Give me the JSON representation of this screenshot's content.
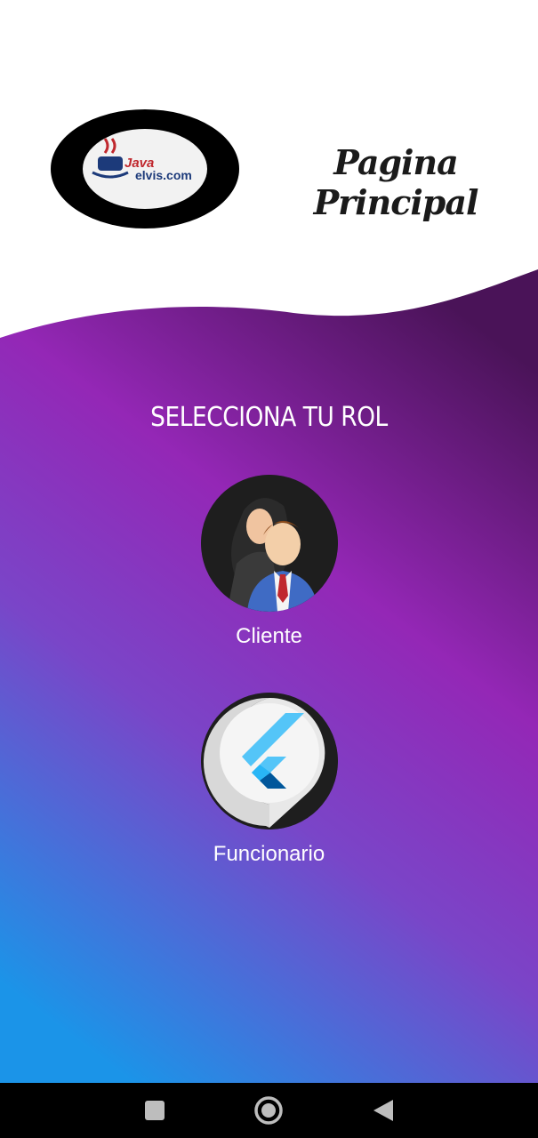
{
  "header": {
    "logo": {
      "icon": "java-elvis-logo",
      "text_line1": "Java",
      "text_line2": "elvis.com"
    },
    "title": "Pagina Principal"
  },
  "main": {
    "section_title": "SELECCIONA TU ROL",
    "roles": [
      {
        "label": "Cliente",
        "icon": "client-avatar-icon"
      },
      {
        "label": "Funcionario",
        "icon": "flutter-logo-icon"
      }
    ]
  },
  "navbar": {
    "items": [
      {
        "icon": "square-recents-icon"
      },
      {
        "icon": "circle-home-icon"
      },
      {
        "icon": "triangle-back-icon"
      }
    ]
  },
  "colors": {
    "gradient_top": "#5c1a6b",
    "gradient_mid": "#9327b8",
    "gradient_bottom": "#1e90e6",
    "navbar": "#000000",
    "accent_red": "#c0282e"
  }
}
